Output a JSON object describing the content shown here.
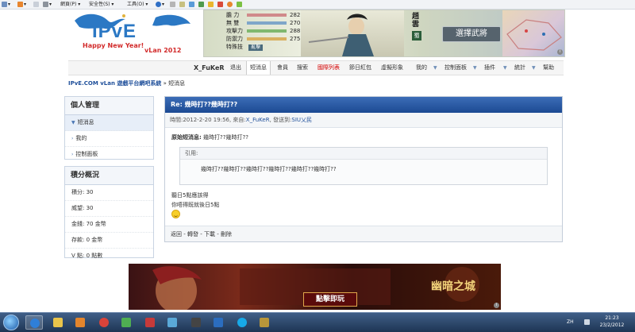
{
  "ie_toolbar": {
    "page_menu": "網頁(P)",
    "safety_menu": "安全性(S)",
    "tools_menu": "工具(O)"
  },
  "logo": {
    "brand": "IPvE",
    "tagline_line1": "Happy New Year!",
    "tagline_line2": "vLan 2012"
  },
  "top_banner": {
    "stats": [
      {
        "label": "膽 力",
        "value": "282",
        "color": "#d08a8a"
      },
      {
        "label": "無 雙",
        "value": "270",
        "color": "#7fa6c9"
      },
      {
        "label": "攻擊力",
        "value": "288",
        "color": "#80b86f"
      },
      {
        "label": "防禦力",
        "value": "275",
        "color": "#d9b060"
      }
    ],
    "skill_label": "特殊技",
    "skill_value": "亂擊",
    "hero_name": "趙雲",
    "hero_tag": "蜀",
    "choose_button": "選擇武將"
  },
  "nav": {
    "username": "X_FuKeR",
    "logout": "退出",
    "messages": "短消息",
    "members": "會員",
    "search": "搜索",
    "intl_list": "國際列表",
    "festival_red": "節日紅包",
    "avatar": "虛擬形象",
    "mine": "我的",
    "control_panel": "控制面板",
    "plugins": "插件",
    "stats": "統計",
    "help": "幫助"
  },
  "breadcrumb": {
    "site": "IPvE.COM vLan 遊戲平台網吧系統",
    "separator": "»",
    "current": "短消息"
  },
  "sidebar": {
    "personal": {
      "title": "個人管理",
      "items": [
        {
          "label": "短消息",
          "active": true
        },
        {
          "label": "我的",
          "active": false
        },
        {
          "label": "控制面板",
          "active": false
        }
      ]
    },
    "points": {
      "title": "積分概況",
      "items": [
        {
          "label": "積分: 30"
        },
        {
          "label": "威望: 30"
        },
        {
          "label": "金錢: 70 金幣"
        },
        {
          "label": "存款: 0 金幣"
        },
        {
          "label": "V 點: 0 點數"
        }
      ]
    }
  },
  "message": {
    "title": "Re: 幾時打??幾時打??",
    "meta_prefix": "時間:2012-2-20 19:56, 來自:",
    "meta_from": "X_FuKeR",
    "meta_mid": ", 發送到:",
    "meta_to": "SIU乂民",
    "original_label": "原始短消息:",
    "original_text": "幾時打??幾時打??",
    "quote_label": "引用:",
    "quote_text": "幾時打??幾時打??幾時打??幾時打??幾時打??幾時打??",
    "reply_line1": "聽日5點應該得",
    "reply_line2": "你唔得既就後日5點",
    "actions": {
      "back": "返回",
      "forward": "轉發",
      "download": "下載",
      "delete": "刪除",
      "sep": " - "
    }
  },
  "bottom_banner": {
    "button": "點擊即玩",
    "title": "幽暗之城"
  },
  "taskbar": {
    "lang": "ZH",
    "time": "21:23",
    "date": "23/2/2012"
  }
}
